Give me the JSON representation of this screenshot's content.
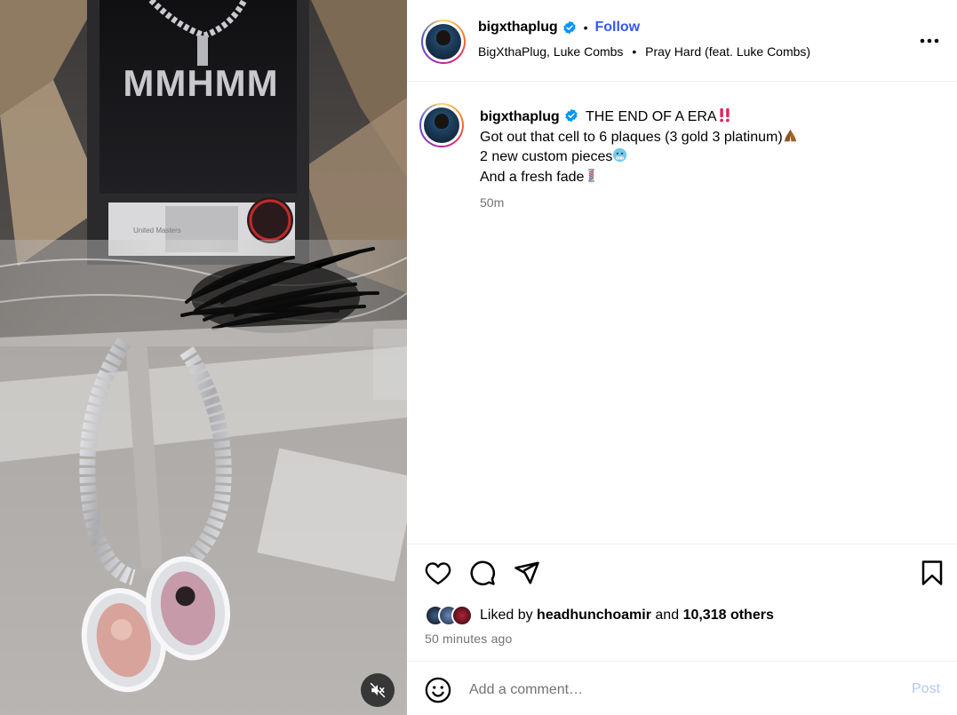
{
  "post": {
    "username": "bigxthaplug",
    "follow_label": "Follow",
    "audio_artists": "BigXthaPlug, Luke Combs",
    "audio_track": "Pray Hard (feat. Luke Combs)",
    "more_icon": "more-horizontal-icon",
    "verified_icon": "verified-badge-icon",
    "verified_color": "#0095f6"
  },
  "media": {
    "plaque_text": "MMHMM",
    "label_text": "United Masters",
    "mute_icon": "speaker-muted-icon"
  },
  "caption": {
    "username": "bigxthaplug",
    "line1_text": "THE END OF A ERA",
    "line1_emoji": "double-exclamation-emoji",
    "line2_text": "Got out that cell to 6 plaques (3 gold 3 platinum)",
    "line2_emoji": "folded-hands-emoji",
    "line3_text": "2 new custom pieces",
    "line3_emoji": "cold-face-emoji",
    "line4_text": "And a fresh fade",
    "line4_emoji": "barber-pole-emoji",
    "time": "50m"
  },
  "actions": {
    "like_icon": "heart-icon",
    "comment_icon": "comment-icon",
    "share_icon": "send-icon",
    "save_icon": "bookmark-icon",
    "liked_by_prefix": "Liked by",
    "liked_by_user": "headhunchoamir",
    "and_text": "and",
    "others_text": "10,318 others",
    "timestamp": "50 minutes ago"
  },
  "comment": {
    "emoji_icon": "smiley-icon",
    "placeholder": "Add a comment…",
    "post_label": "Post",
    "post_color": "#b3c7f5"
  },
  "colors": {
    "follow": "#3856f0",
    "muted_text": "#737373",
    "divider": "#efefef"
  }
}
